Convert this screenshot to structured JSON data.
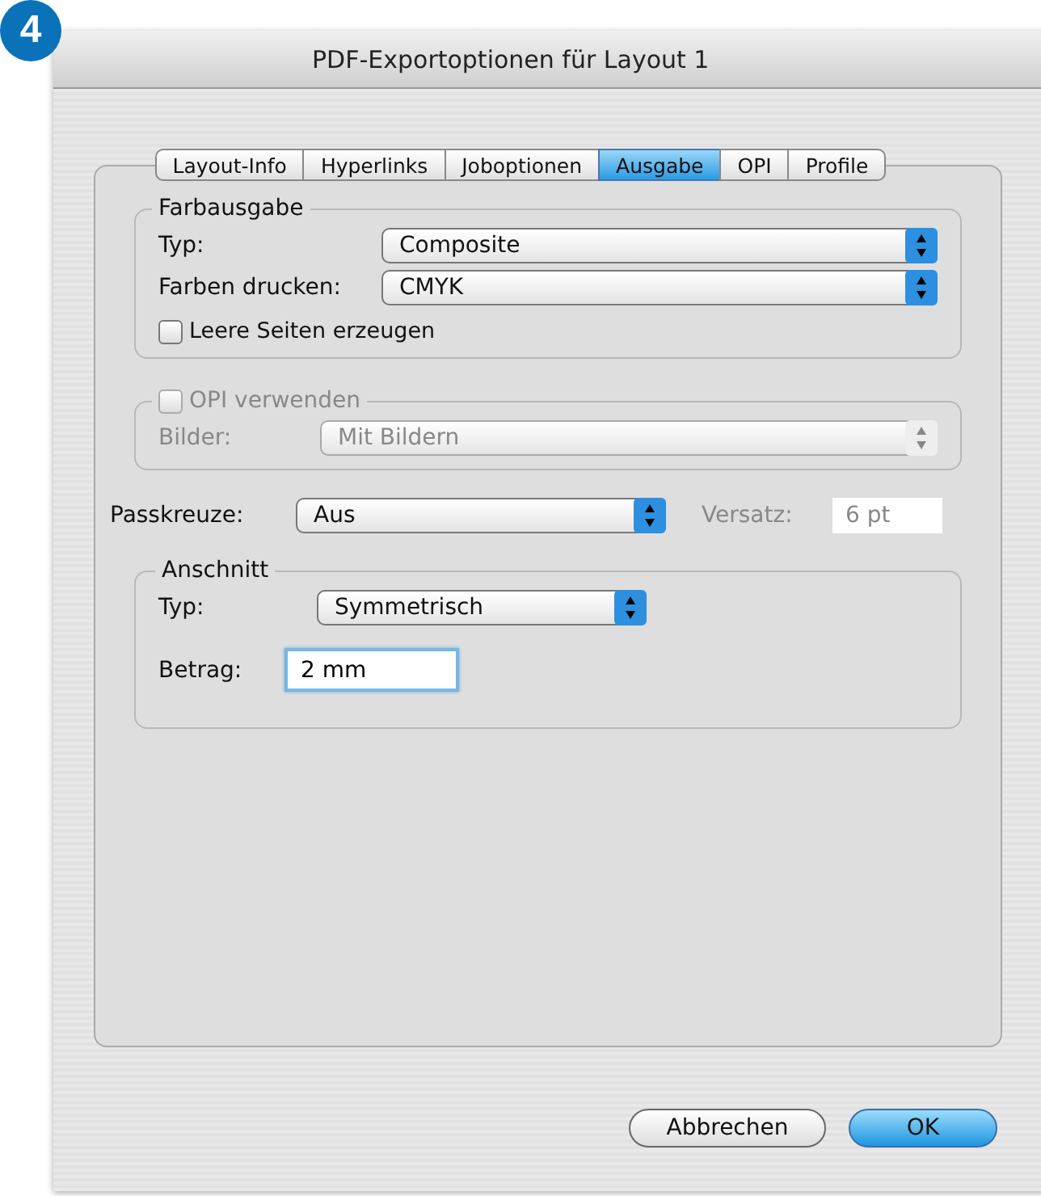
{
  "badge": "4",
  "window": {
    "title": "PDF-Exportoptionen für Layout 1"
  },
  "tabs": [
    {
      "label": "Layout-Info",
      "selected": false
    },
    {
      "label": "Hyperlinks",
      "selected": false
    },
    {
      "label": "Joboptionen",
      "selected": false
    },
    {
      "label": "Ausgabe",
      "selected": true
    },
    {
      "label": "OPI",
      "selected": false
    },
    {
      "label": "Profile",
      "selected": false
    }
  ],
  "farbausgabe": {
    "title": "Farbausgabe",
    "rows": [
      {
        "label": "Typ:",
        "value": "Composite"
      },
      {
        "label": "Farben drucken:",
        "value": "CMYK"
      }
    ],
    "checkbox": {
      "label": "Leere Seiten erzeugen",
      "checked": false
    }
  },
  "opi": {
    "checkbox": {
      "label": "OPI verwenden",
      "checked": false
    },
    "disabled": true,
    "label": "Bilder:",
    "value": "Mit Bildern"
  },
  "passkreuze": {
    "label": "Passkreuze:",
    "value": "Aus"
  },
  "versatz": {
    "label": "Versatz:",
    "value": "6 pt",
    "disabled": true
  },
  "anschnitt": {
    "title": "Anschnitt",
    "typ_label": "Typ:",
    "typ_value": "Symmetrisch",
    "betrag_label": "Betrag:",
    "betrag_value": "2 mm"
  },
  "buttons": [
    {
      "label": "Abbrechen",
      "default": false
    },
    {
      "label": "OK",
      "default": true
    }
  ]
}
